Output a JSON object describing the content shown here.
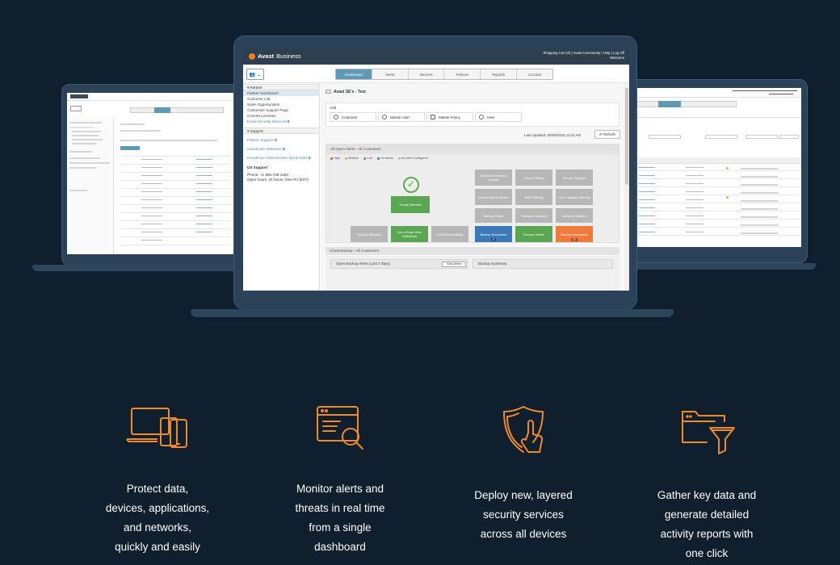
{
  "main_app": {
    "brand_name": "Avast",
    "brand_suffix": "Business",
    "top_links_line1": "Shopping Cart (0)  |  Avast Community  |  Help  |  Log Off",
    "top_links_line2": "Welcome",
    "user_menu": "👥 ⌄",
    "tabs": [
      {
        "label": "Dashboard",
        "active": true
      },
      {
        "label": "Alerts",
        "active": false
      },
      {
        "label": "Devices",
        "active": false
      },
      {
        "label": "Policies",
        "active": false
      },
      {
        "label": "Reports",
        "active": false
      },
      {
        "label": "Account",
        "active": false
      }
    ],
    "sidebar": {
      "partner_header": "▾ Partner",
      "partner_links": [
        "Partner Dashboard",
        "Customer List",
        "Sales Opportunities",
        "Customize Support Page",
        "Convert Licenses",
        "Email Security Services ⧉"
      ],
      "support_header": "▾ Support",
      "support_links": [
        "Partner Support ⧉",
        "CloudCare Webinars ⧉",
        "CloudCare Administrator Quick Start ⧉"
      ],
      "us_support_title": "US Support",
      "phone": "Phone: +1 855-738-1284",
      "hours": "Open hours: 24 hours, Mon-Fri (EST)"
    },
    "page_title": "Avast SE's - Test",
    "add_label": "Add",
    "add_buttons": [
      "Customer",
      "Master Alert",
      "Master Policy",
      "User"
    ],
    "last_updated": "Last Updated: 00/00/2018 11:02 AM",
    "refresh": "⟳ Refresh",
    "panel_title": "All Open Alerts - All Customers",
    "legend": [
      {
        "label": "High",
        "color": "#e2523c"
      },
      {
        "label": "Medium",
        "color": "#f2a93b"
      },
      {
        "label": "Low",
        "color": "#5aa652"
      },
      {
        "label": "No Alerts",
        "color": "#3d79b8"
      },
      {
        "label": "No Alert Configured",
        "color": "#bdbdbd"
      }
    ],
    "check_mark": "✓",
    "tiles": [
      {
        "label": "Threat Detected",
        "color": "green"
      },
      {
        "label": "Endpoint Licensing Controls",
        "color": "grey"
      },
      {
        "label": "Device Offline",
        "color": "grey"
      },
      {
        "label": "Service Stopped",
        "color": "grey"
      },
      {
        "label": "Device Needs Restart",
        "color": "grey"
      },
      {
        "label": "Web Filtering",
        "color": "grey"
      },
      {
        "label": "Disk Capacity Warning",
        "color": "grey"
      },
      {
        "label": "Backup Failed",
        "color": "grey"
      },
      {
        "label": "Software Updated",
        "color": "grey"
      },
      {
        "label": "Antivirus Installed",
        "color": "grey"
      },
      {
        "label": "Firewall Disabled",
        "color": "grey"
      },
      {
        "label": "Backup Successful",
        "color": "blue",
        "count": "5"
      },
      {
        "label": "Devices Online",
        "color": "green"
      },
      {
        "label": "Backup Incomplete",
        "color": "orange",
        "count": "22"
      },
      {
        "label": "Out of Date Virus Definitions",
        "color": "green"
      },
      {
        "label": "Patch Not Installed",
        "color": "grey"
      }
    ],
    "cloud_backup_title": "Cloud Backup - All Customers",
    "open_backup_alerts": "Open Backup Alerts (Last 7 days)",
    "view_alerts": "View Alerts",
    "backup_summary": "Backup Summary"
  },
  "features": [
    {
      "icon": "devices-icon",
      "lines": [
        "Protect data,",
        "devices, applications,",
        "and networks,",
        "quickly and easily"
      ]
    },
    {
      "icon": "monitor-search-icon",
      "lines": [
        "Monitor alerts and",
        "threats in real time",
        "from a single",
        "dashboard"
      ]
    },
    {
      "icon": "shield-touch-icon",
      "lines": [
        "Deploy new, layered",
        "security services",
        "across all devices"
      ]
    },
    {
      "icon": "folder-filter-icon",
      "lines": [
        "Gather key data and",
        "generate detailed",
        "activity reports with",
        "one click"
      ]
    }
  ],
  "colors": {
    "background": "#0f1f2e",
    "accent": "#f08a24",
    "laptop": "#2b4258"
  }
}
